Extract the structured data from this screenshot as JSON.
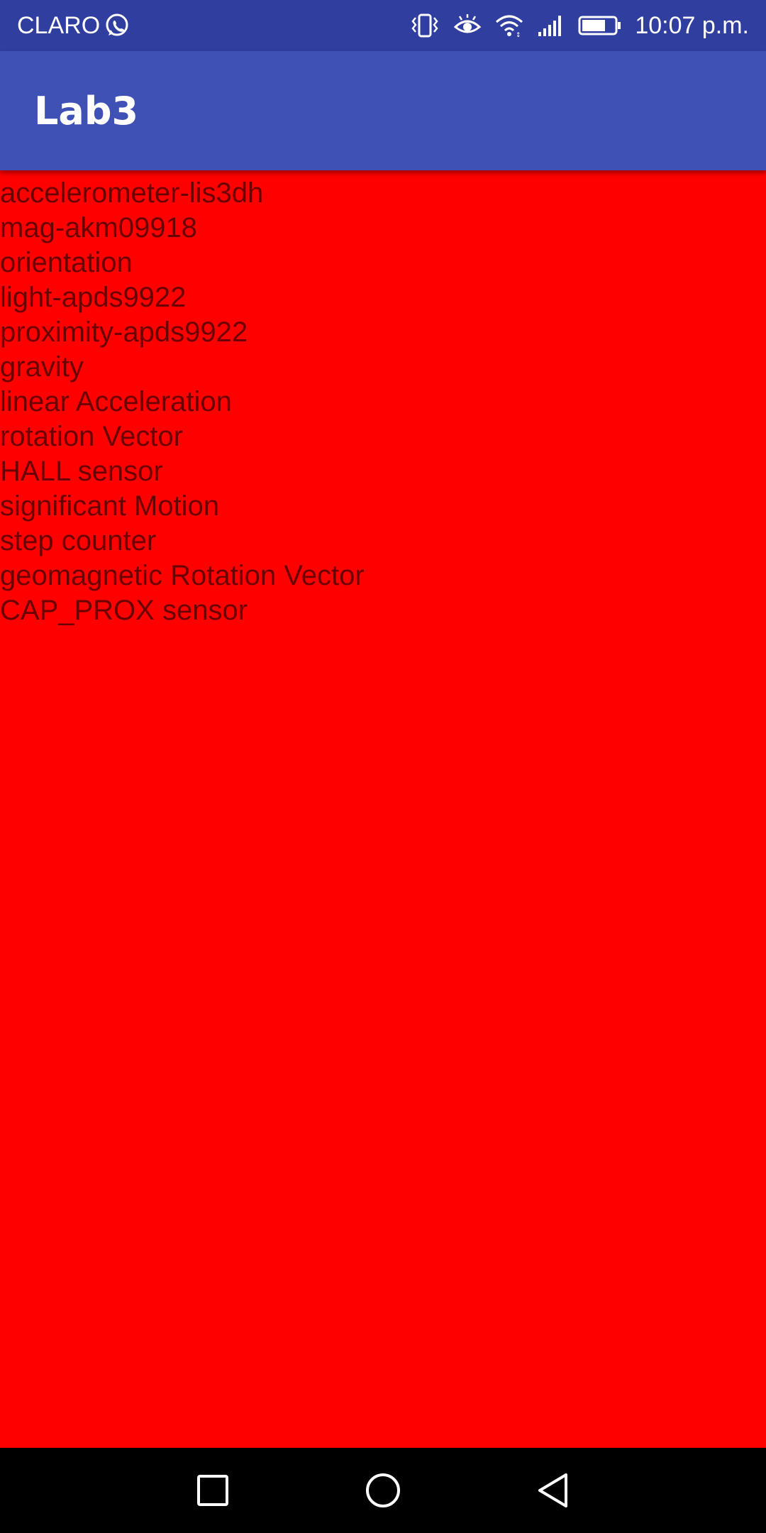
{
  "status_bar": {
    "carrier": "CLARO",
    "time": "10:07 p.m.",
    "icons": [
      "whatsapp-icon",
      "vibrate-icon",
      "eye-comfort-icon",
      "wifi-icon",
      "signal-icon",
      "battery-icon"
    ]
  },
  "app_bar": {
    "title": "Lab3"
  },
  "sensors": [
    "accelerometer-lis3dh",
    "mag-akm09918",
    "orientation",
    "light-apds9922",
    "proximity-apds9922",
    "gravity",
    "linear Acceleration",
    "rotation Vector",
    "HALL sensor",
    "significant Motion",
    "step counter",
    "geomagnetic Rotation Vector",
    "CAP_PROX sensor"
  ],
  "nav_bar": {
    "buttons": [
      "recents-button",
      "home-button",
      "back-button"
    ]
  },
  "colors": {
    "status_bar": "#303f9f",
    "app_bar": "#3f51b5",
    "background": "#ff0000",
    "nav_bar": "#000000"
  }
}
